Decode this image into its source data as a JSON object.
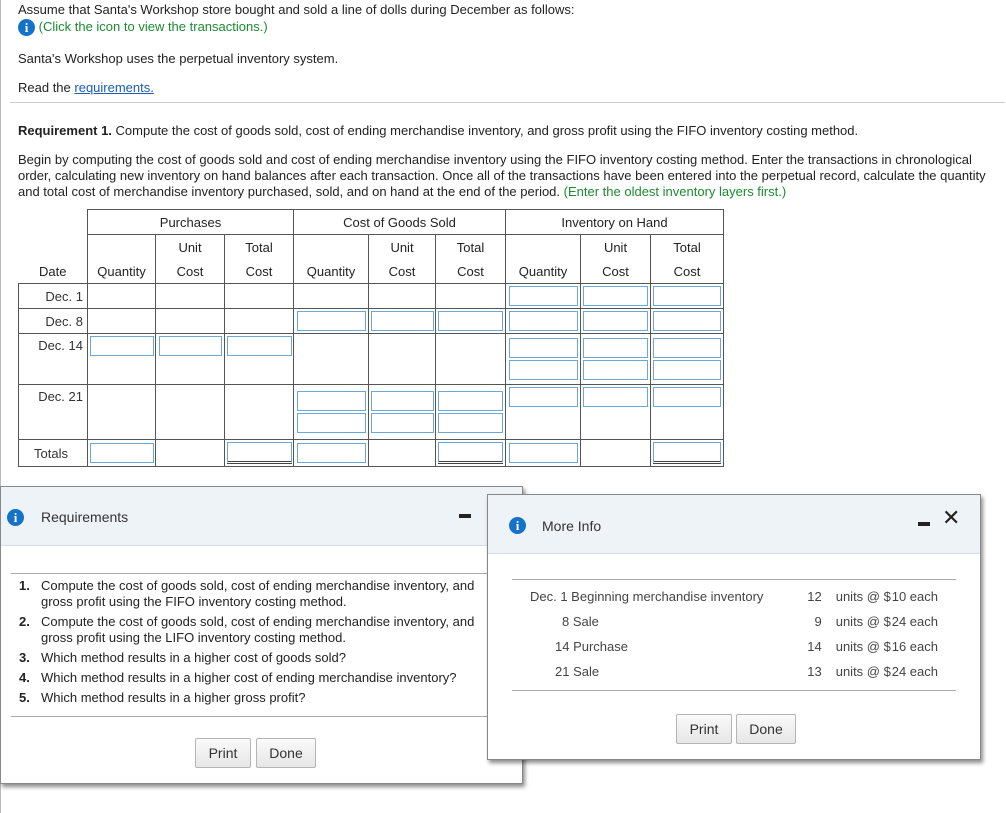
{
  "intro": {
    "line1": "Assume that Santa's Workshop store bought and sold a line of dolls during December as follows:",
    "click_note": "(Click the icon to view the transactions.)",
    "system_note": "Santa's Workshop uses the perpetual inventory system.",
    "read_prefix": "Read the",
    "read_link": "requirements."
  },
  "requirement": {
    "label": "Requirement 1.",
    "text": " Compute the cost of goods sold, cost of ending merchandise inventory, and gross profit using the FIFO inventory costing method.",
    "instr1": "Begin by computing the cost of goods sold and cost of ending merchandise inventory using the FIFO inventory costing method. Enter the transactions in chronological",
    "instr2": "order, calculating new inventory on hand balances after each transaction. Once all of the transactions have been entered into the perpetual record, calculate the quantity",
    "instr3": "and total cost of merchandise inventory purchased, sold, and on hand at the end of the period.",
    "instr_hint": "(Enter the oldest inventory layers first.)"
  },
  "table": {
    "groups": [
      "Purchases",
      "Cost of Goods Sold",
      "Inventory on Hand"
    ],
    "unit": "Unit",
    "total": "Total",
    "date": "Date",
    "quantity": "Quantity",
    "cost": "Cost",
    "rows": [
      "Dec. 1",
      "Dec. 8",
      "Dec. 14",
      "Dec. 21"
    ],
    "totals": "Totals"
  },
  "req_dialog": {
    "title": "Requirements",
    "items": [
      {
        "n": "1.",
        "text": "Compute the cost of goods sold, cost of ending merchandise inventory, and gross profit using the FIFO inventory costing method."
      },
      {
        "n": "2.",
        "text": "Compute the cost of goods sold, cost of ending merchandise inventory, and gross profit using the LIFO inventory costing method."
      },
      {
        "n": "3.",
        "text": "Which method results in a higher cost of goods sold?"
      },
      {
        "n": "4.",
        "text": "Which method results in a higher cost of ending merchandise inventory?"
      },
      {
        "n": "5.",
        "text": "Which method results in a higher gross profit?"
      }
    ],
    "print": "Print",
    "done": "Done"
  },
  "info_dialog": {
    "title": "More Info",
    "rows": [
      {
        "desc": "Dec. 1 Beginning merchandise inventory",
        "qty": "12",
        "units": "units @ $",
        "price": "10 each"
      },
      {
        "desc": "8 Sale",
        "qty": "9",
        "units": "units @ $",
        "price": "24 each"
      },
      {
        "desc": "14 Purchase",
        "qty": "14",
        "units": "units @ $",
        "price": "16 each"
      },
      {
        "desc": "21 Sale",
        "qty": "13",
        "units": "units @ $",
        "price": "24 each"
      }
    ],
    "print": "Print",
    "done": "Done"
  }
}
